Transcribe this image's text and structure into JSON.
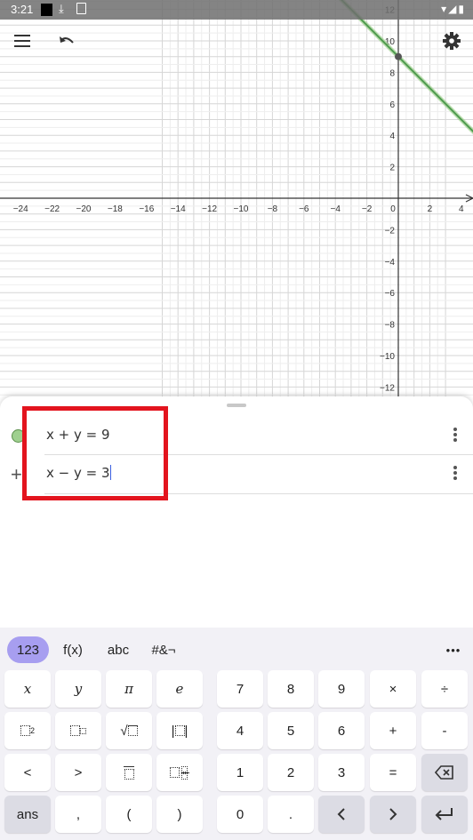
{
  "status_bar": {
    "time": "3:21",
    "download_icon": "download-icon",
    "right_icons": "▾◢▮"
  },
  "toolbar": {
    "menu_icon": "menu-icon",
    "undo_icon": "undo-icon",
    "settings_icon": "settings-icon"
  },
  "graph": {
    "x_ticks": [
      "−24",
      "−22",
      "−20",
      "−18",
      "−16",
      "−14",
      "−12",
      "−10",
      "−8",
      "−6",
      "−4",
      "−2",
      "0",
      "2",
      "4"
    ],
    "y_ticks": [
      "12",
      "10",
      "8",
      "6",
      "4",
      "2",
      "−2",
      "−4",
      "−6",
      "−8",
      "−10",
      "−12"
    ],
    "line_color": "#4f9b4f",
    "line": {
      "equation": "x + y = 9"
    },
    "point": {
      "x": 0,
      "y": 9
    }
  },
  "algebra": {
    "rows": [
      {
        "expression": "x + y  =  9",
        "color": "#9fd08f"
      },
      {
        "expression": "x − y  =  3"
      }
    ]
  },
  "keyboard": {
    "tabs": [
      "123",
      "f(x)",
      "abc",
      "#&¬"
    ],
    "more": "•••",
    "left_keys": {
      "r1": [
        "x",
        "y",
        "π",
        "e"
      ],
      "r3": [
        "<",
        ">"
      ],
      "r4": [
        "ans",
        ",",
        "(",
        ")"
      ]
    },
    "num_keys": {
      "r1": [
        "7",
        "8",
        "9",
        "×",
        "÷"
      ],
      "r2": [
        "4",
        "5",
        "6",
        "+",
        "-"
      ],
      "r3": [
        "1",
        "2",
        "3",
        "="
      ],
      "r4": [
        "0",
        "."
      ]
    }
  },
  "colors": {
    "accent": "#a79ef0",
    "highlight": "#e3141e"
  }
}
